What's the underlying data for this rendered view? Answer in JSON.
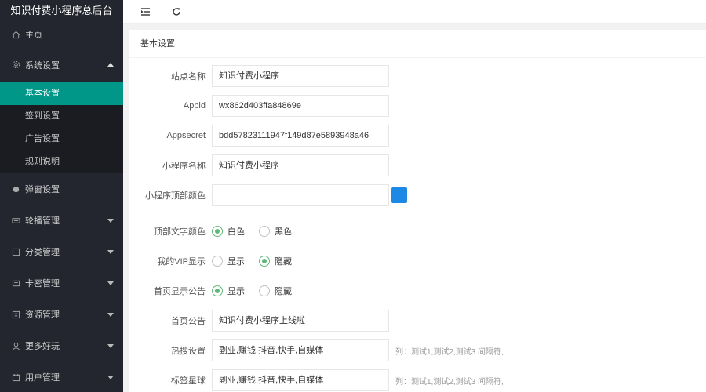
{
  "sidebar": {
    "title": "知识付费小程序总后台",
    "items": [
      {
        "label": "主页",
        "icon": "home-icon"
      },
      {
        "label": "系统设置",
        "icon": "gear-icon"
      },
      {
        "label": "弹窗设置",
        "icon": "popup-icon"
      },
      {
        "label": "轮播管理",
        "icon": "carousel-icon"
      },
      {
        "label": "分类管理",
        "icon": "category-icon"
      },
      {
        "label": "卡密管理",
        "icon": "card-icon"
      },
      {
        "label": "资源管理",
        "icon": "resource-icon"
      },
      {
        "label": "更多好玩",
        "icon": "more-icon"
      },
      {
        "label": "用户管理",
        "icon": "user-icon"
      }
    ],
    "sub_items": [
      "基本设置",
      "签到设置",
      "广告设置",
      "规则说明"
    ]
  },
  "topbar": {
    "menu_icon": "menu-fold-icon",
    "refresh_icon": "refresh-icon"
  },
  "card": {
    "title": "基本设置"
  },
  "form": {
    "site_name": {
      "label": "站点名称",
      "value": "知识付费小程序"
    },
    "appid": {
      "label": "Appid",
      "value": "wx862d403ffa84869e"
    },
    "appsecret": {
      "label": "Appsecret",
      "value": "bdd57823111947f149d87e5893948a46"
    },
    "mp_name": {
      "label": "小程序名称",
      "value": "知识付费小程序"
    },
    "top_color": {
      "label": "小程序顶部颜色",
      "value": "",
      "swatch": "#1e88e5"
    },
    "top_text_color": {
      "label": "顶部文字颜色",
      "options": [
        "白色",
        "黑色"
      ],
      "selected": "白色"
    },
    "my_vip": {
      "label": "我的VIP显示",
      "options": [
        "显示",
        "隐藏"
      ],
      "selected": "隐藏"
    },
    "home_notice_show": {
      "label": "首页显示公告",
      "options": [
        "显示",
        "隐藏"
      ],
      "selected": "显示"
    },
    "home_notice": {
      "label": "首页公告",
      "value": "知识付费小程序上线啦"
    },
    "hot_search": {
      "label": "热搜设置",
      "value": "副业,赚钱,抖音,快手,自媒体",
      "hint": "列：测试1,测试2,测试3 间隔符,"
    },
    "tag_ball": {
      "label": "标签星球",
      "value": "副业,赚钱,抖音,快手,自媒体",
      "hint": "列：测试1,测试2,测试3 间隔符,"
    }
  }
}
